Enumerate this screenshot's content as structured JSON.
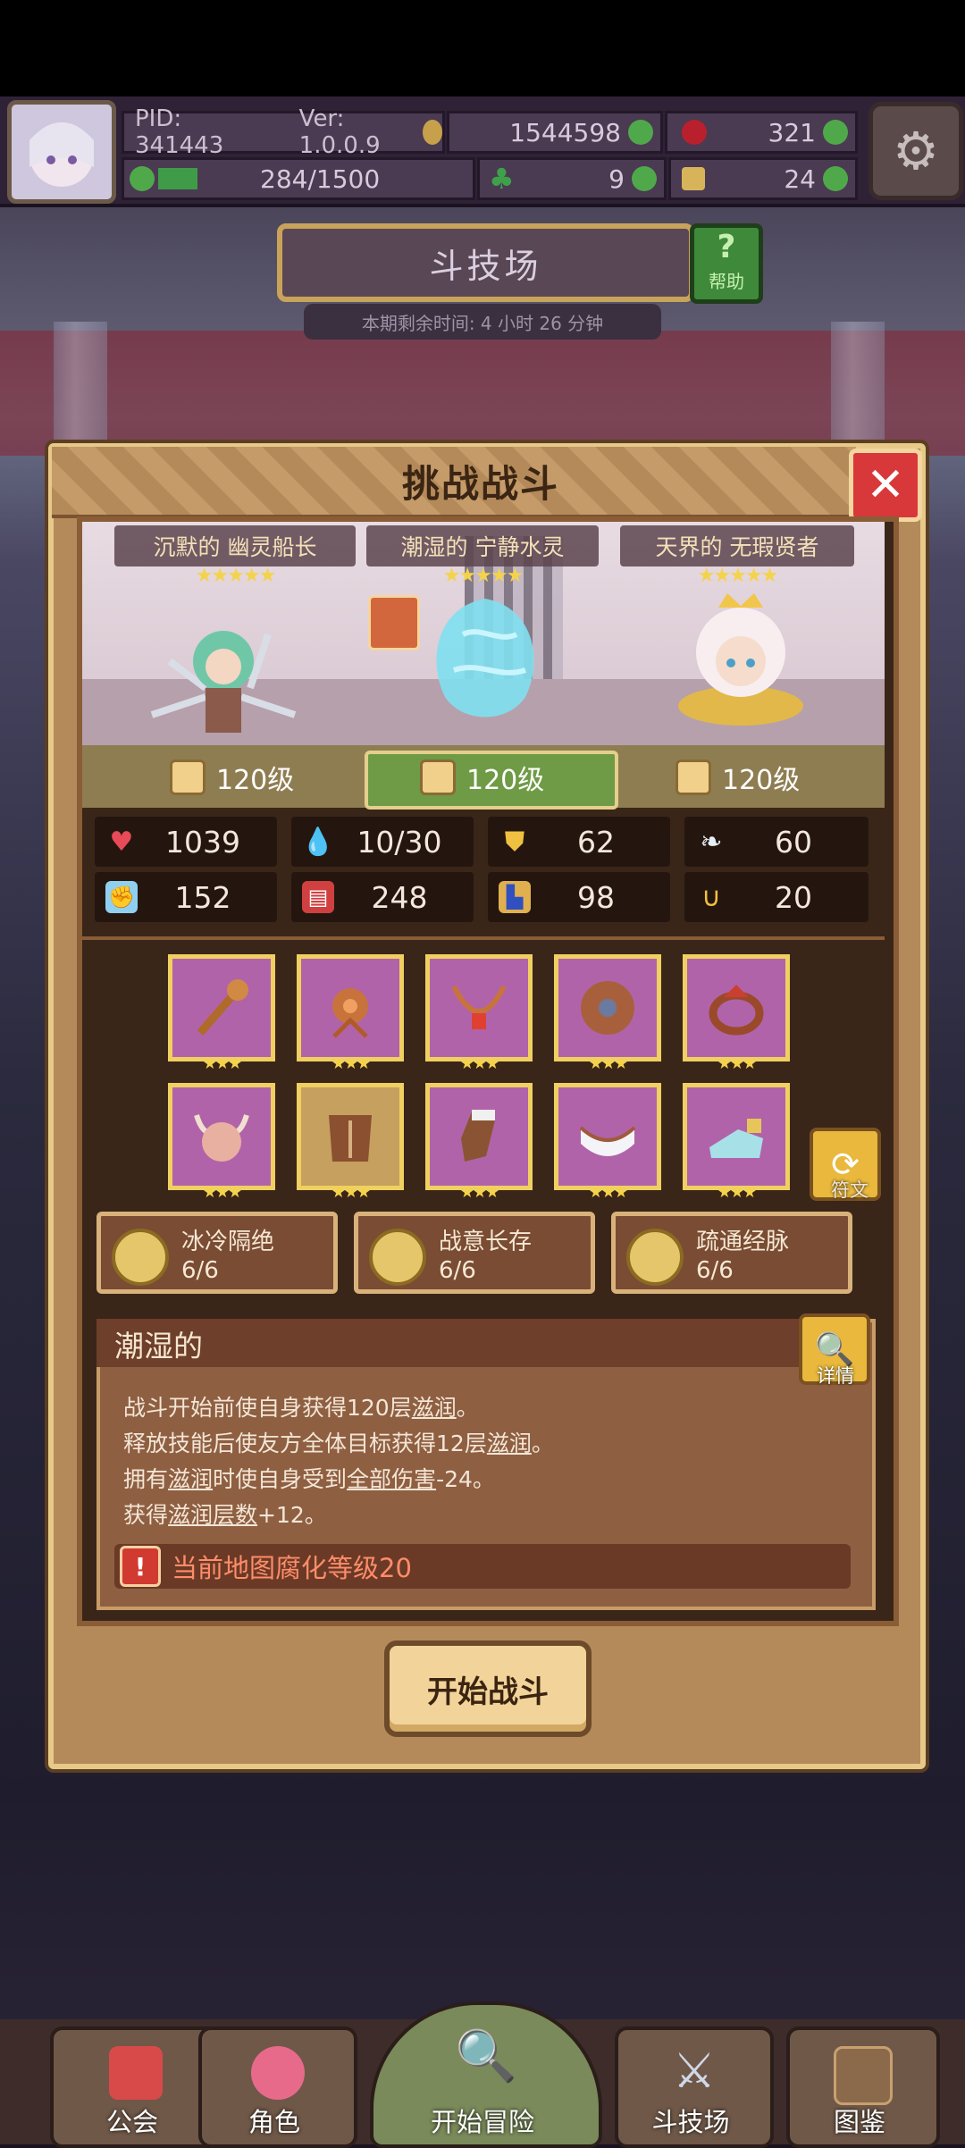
{
  "hud": {
    "pid": "PID: 341443",
    "version": "Ver: 1.0.0.9",
    "gold": "1544598",
    "gems": "321",
    "stamina": "284/1500",
    "clover": "9",
    "boots": "24"
  },
  "arena": {
    "title": "斗技场",
    "help_label": "帮助",
    "timer": "本期剩余时间: 4 小时 26 分钟"
  },
  "modal": {
    "title": "挑战战斗",
    "close": "✕",
    "start_label": "开始战斗"
  },
  "heroes": [
    {
      "name": "沉默的 幽灵船长",
      "stars": "★★★★★",
      "level": "120级"
    },
    {
      "name": "潮湿的 宁静水灵",
      "stars": "★★★★★",
      "level": "120级"
    },
    {
      "name": "天界的 无瑕贤者",
      "stars": "★★★★★",
      "level": "120级"
    }
  ],
  "stats": [
    {
      "icon": "heart-icon",
      "value": "1039"
    },
    {
      "icon": "water-drop-icon",
      "value": "10/30"
    },
    {
      "icon": "shield-icon",
      "value": "62"
    },
    {
      "icon": "wing-icon",
      "value": "60"
    },
    {
      "icon": "fist-icon",
      "value": "152"
    },
    {
      "icon": "spellbook-icon",
      "value": "248"
    },
    {
      "icon": "boot-icon",
      "value": "98"
    },
    {
      "icon": "horseshoe-icon",
      "value": "20"
    }
  ],
  "equipment": [
    {
      "name": "staff",
      "stars": "★★★"
    },
    {
      "name": "amulet",
      "stars": "★★★"
    },
    {
      "name": "necklace",
      "stars": "★★★"
    },
    {
      "name": "round-shield",
      "stars": "★★★"
    },
    {
      "name": "ring",
      "stars": "★★★"
    },
    {
      "name": "horned-helmet",
      "stars": "★★★"
    },
    {
      "name": "armor",
      "stars": "★★★"
    },
    {
      "name": "gloves",
      "stars": "★★★"
    },
    {
      "name": "belt",
      "stars": "★★★"
    },
    {
      "name": "shoes",
      "stars": "★★★"
    }
  ],
  "rune_label": "符文",
  "bonuses": [
    {
      "name": "冰冷隔绝",
      "count": "6/6"
    },
    {
      "name": "战意长存",
      "count": "6/6"
    },
    {
      "name": "疏通经脉",
      "count": "6/6"
    }
  ],
  "trait": {
    "title": "潮湿的",
    "detail_label": "详情",
    "l1a": "战斗开始前使自身获得120层",
    "l1b": "滋润",
    "l1c": "。",
    "l2a": "释放技能后使友方全体目标获得12层",
    "l2b": "滋润",
    "l2c": "。",
    "l3a": "拥有",
    "l3b": "滋润",
    "l3c": "时使自身受到",
    "l3d": "全部伤害",
    "l3e": "-24。",
    "l4a": "获得",
    "l4b": "滋润层数",
    "l4c": "+12。",
    "corrupt": "当前地图腐化等级20"
  },
  "nav": [
    {
      "label": "公会"
    },
    {
      "label": "角色"
    },
    {
      "label": "开始冒险"
    },
    {
      "label": "斗技场"
    },
    {
      "label": "图鉴"
    }
  ]
}
